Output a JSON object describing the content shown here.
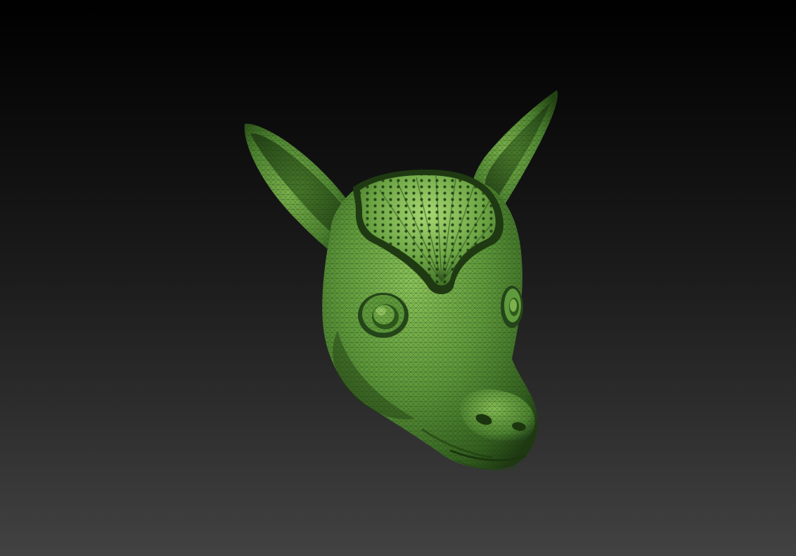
{
  "viewport": {
    "background_top": "#000000",
    "background_bottom": "#424242"
  },
  "model": {
    "subject": "deer-head-sculpt",
    "material_colors": {
      "base": "#5f9a3c",
      "highlight": "#8cc45a",
      "shadow": "#1f3a12",
      "wire": "#17300c"
    }
  }
}
